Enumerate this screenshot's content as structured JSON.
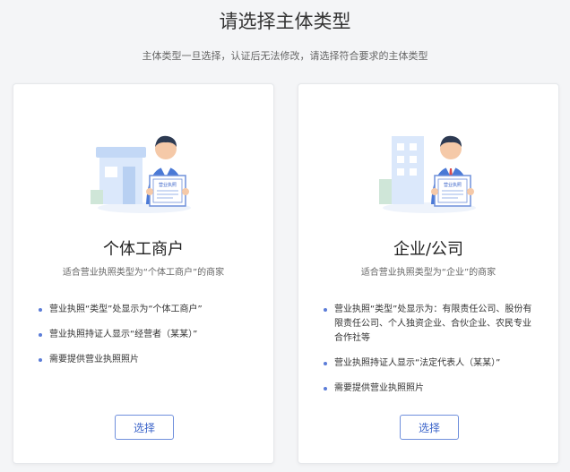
{
  "header": {
    "title": "请选择主体类型",
    "subtitle": "主体类型一旦选择，认证后无法修改，请选择符合要求的主体类型"
  },
  "cards": [
    {
      "title": "个体工商户",
      "description": "适合营业执照类型为“个体工商户”的商家",
      "license_text": "营业执照",
      "features": [
        "营业执照“类型”处显示为“个体工商户”",
        "营业执照持证人显示“经营者（某某）”",
        "需要提供营业执照照片"
      ],
      "button_label": "选择"
    },
    {
      "title": "企业/公司",
      "description": "适合营业执照类型为“企业”的商家",
      "license_text": "营业执照",
      "features": [
        "营业执照“类型”处显示为：有限责任公司、股份有限责任公司、个人独资企业、合伙企业、农民专业合作社等",
        "营业执照持证人显示“法定代表人（某某）”",
        "需要提供营业执照照片"
      ],
      "button_label": "选择"
    }
  ],
  "colors": {
    "accent": "#3b64c9",
    "bullet": "#5b7cd8",
    "illustration_light_blue": "#dbe8fb"
  }
}
